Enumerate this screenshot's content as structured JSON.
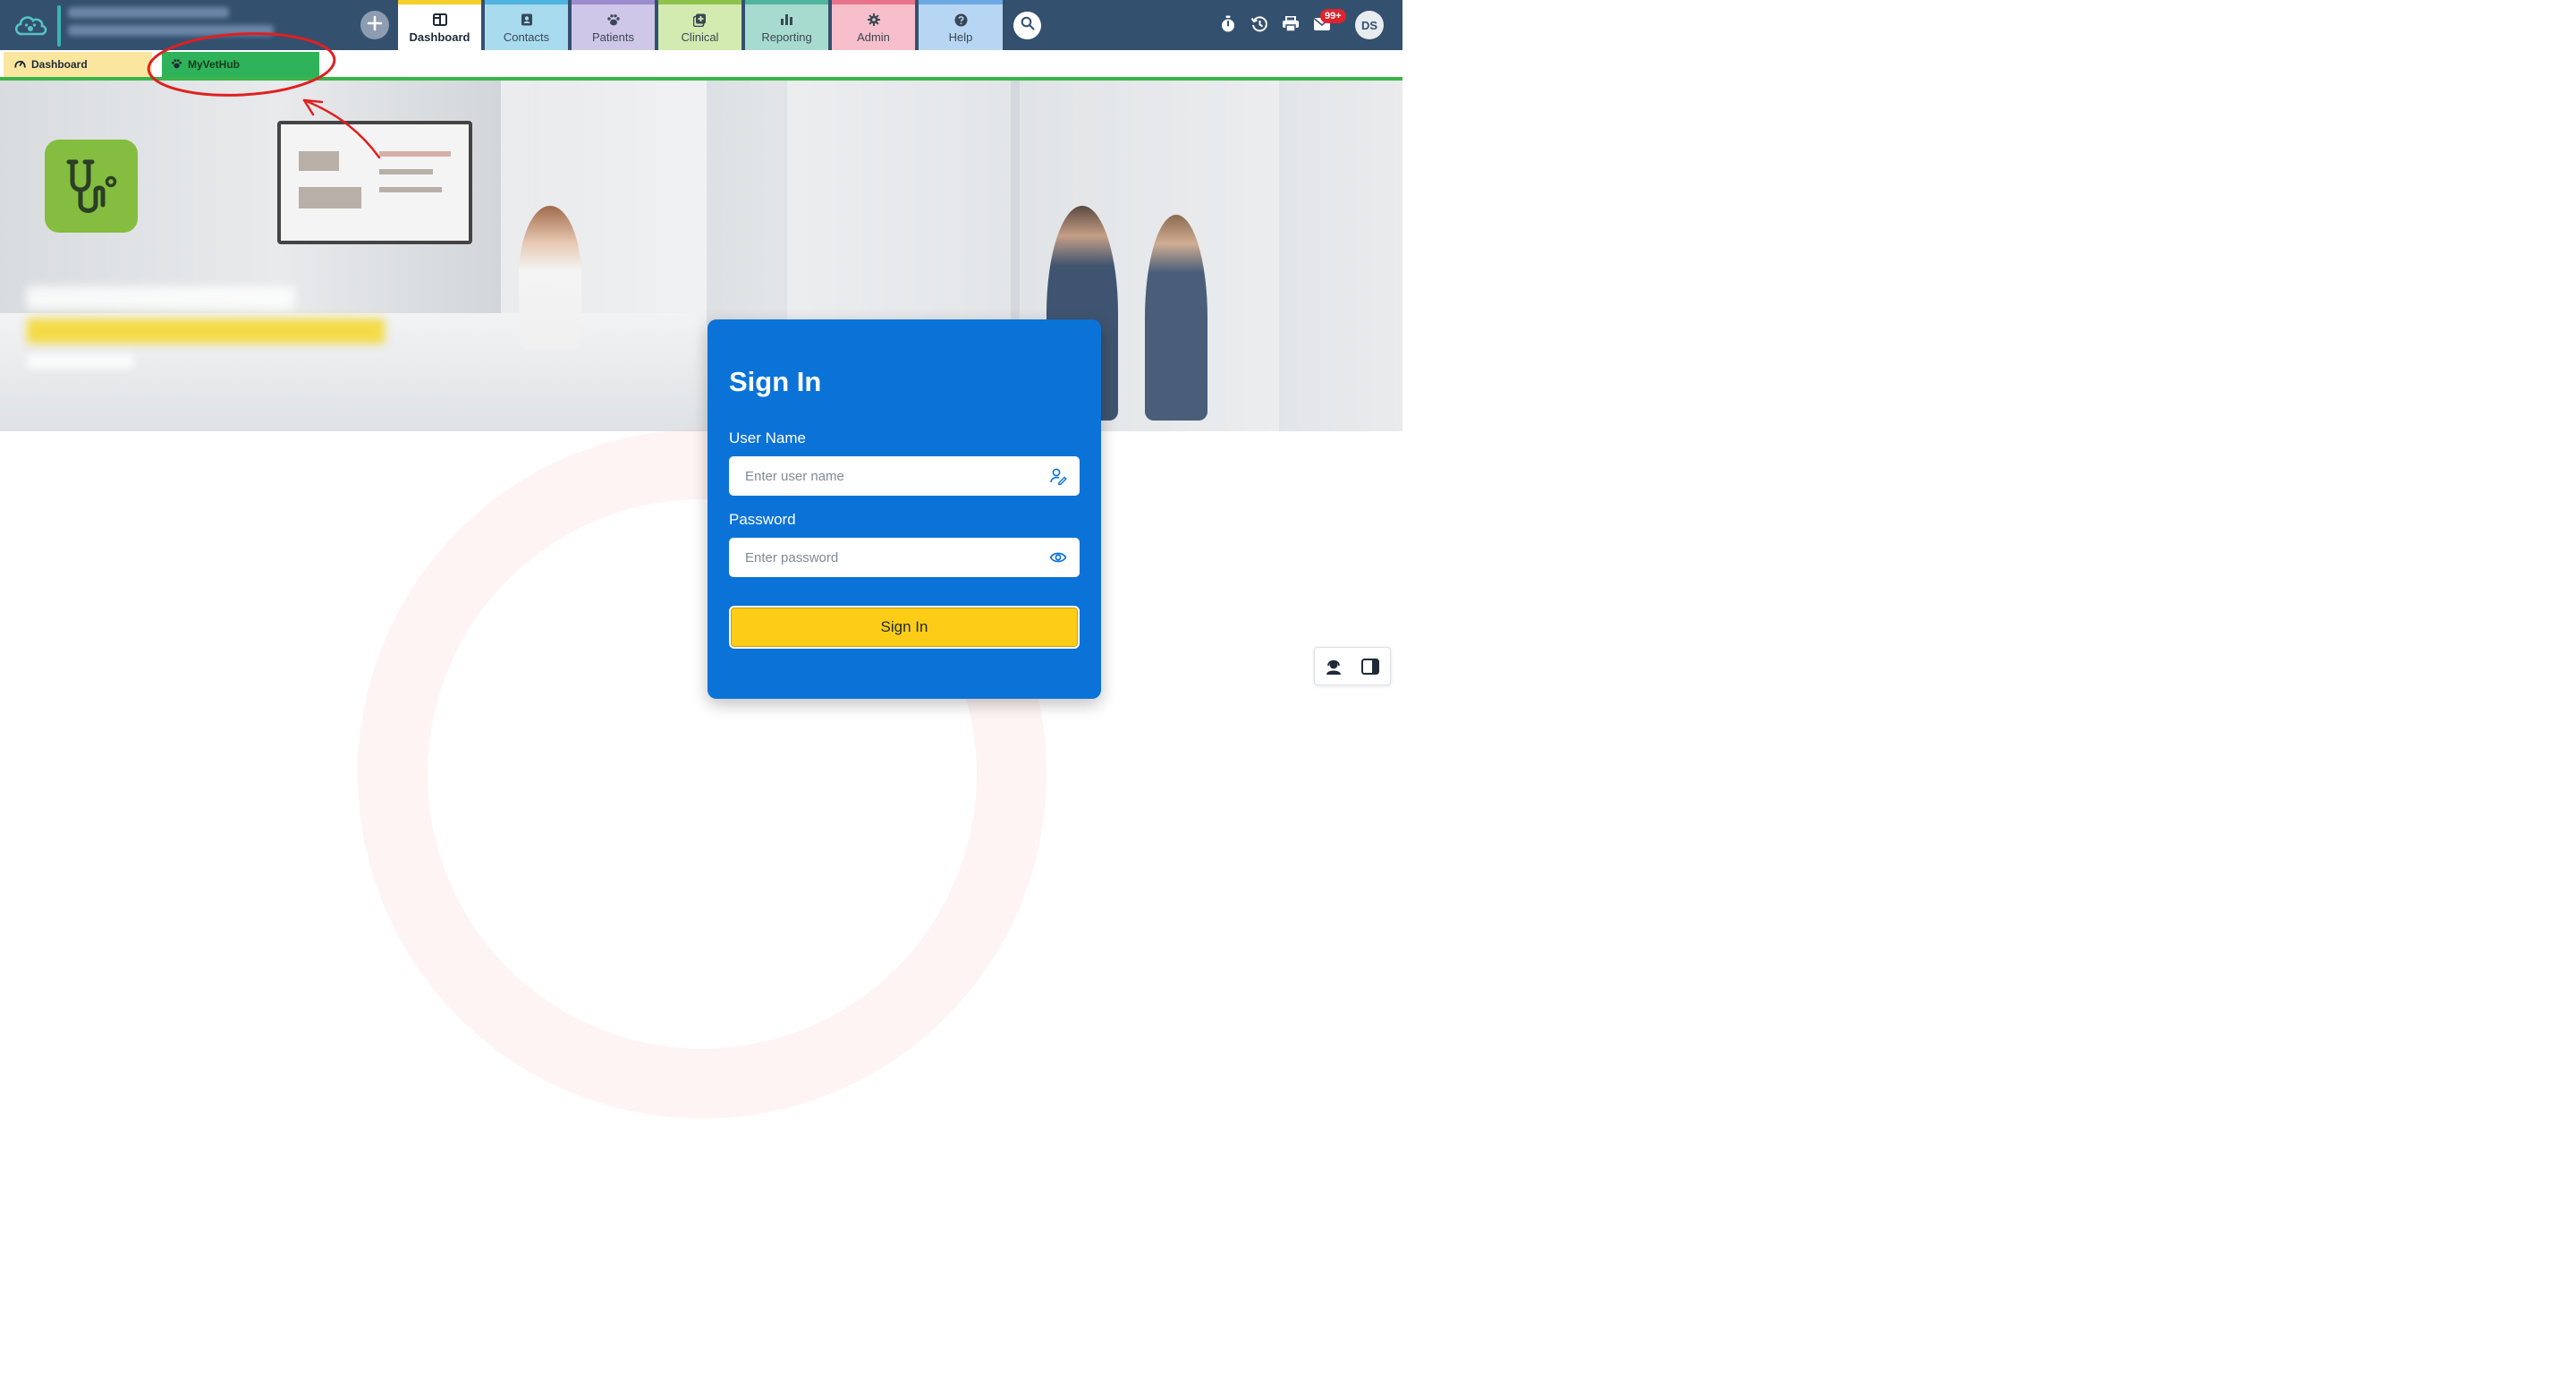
{
  "header": {
    "logo_icon": "cloud-paw-icon",
    "add_icon": "plus-icon",
    "tabs": [
      {
        "label": "Dashboard",
        "icon": "dashboard-icon",
        "color": "#ffffff",
        "accent": "#f5cf2a",
        "active": true
      },
      {
        "label": "Contacts",
        "icon": "contact-card-icon",
        "color": "#a9dbef",
        "accent": "#4fb3e0",
        "active": false
      },
      {
        "label": "Patients",
        "icon": "paw-icon",
        "color": "#cfc7e8",
        "accent": "#9b8ccf",
        "active": false
      },
      {
        "label": "Clinical",
        "icon": "medical-plus-icon",
        "color": "#d3eab0",
        "accent": "#8fc24d",
        "active": false
      },
      {
        "label": "Reporting",
        "icon": "bar-chart-icon",
        "color": "#a8dbcf",
        "accent": "#4fb59e",
        "active": false
      },
      {
        "label": "Admin",
        "icon": "gear-icon",
        "color": "#f6bfcb",
        "accent": "#e8748c",
        "active": false
      },
      {
        "label": "Help",
        "icon": "question-icon",
        "color": "#b7d6f3",
        "accent": "#6aa9e3",
        "active": false
      }
    ],
    "right_icons": [
      "stopwatch-icon",
      "history-icon",
      "printer-icon",
      "mail-icon"
    ],
    "mail_badge": "99+",
    "avatar_initials": "DS"
  },
  "subtabs": [
    {
      "label": "Dashboard",
      "icon": "gauge-icon"
    },
    {
      "label": "MyVetHub",
      "icon": "paw-icon"
    }
  ],
  "signin": {
    "title": "Sign In",
    "username_label": "User Name",
    "username_placeholder": "Enter user name",
    "username_value": "",
    "password_label": "Password",
    "password_placeholder": "Enter password",
    "password_value": "",
    "button_label": "Sign In"
  },
  "floating_tools": [
    "support-agent-icon",
    "side-panel-icon"
  ],
  "colors": {
    "topbar": "#34506f",
    "card": "#0b72d8",
    "button": "#fdcc17",
    "annotation": "#e02020",
    "hub_tab": "#2fb35a"
  }
}
